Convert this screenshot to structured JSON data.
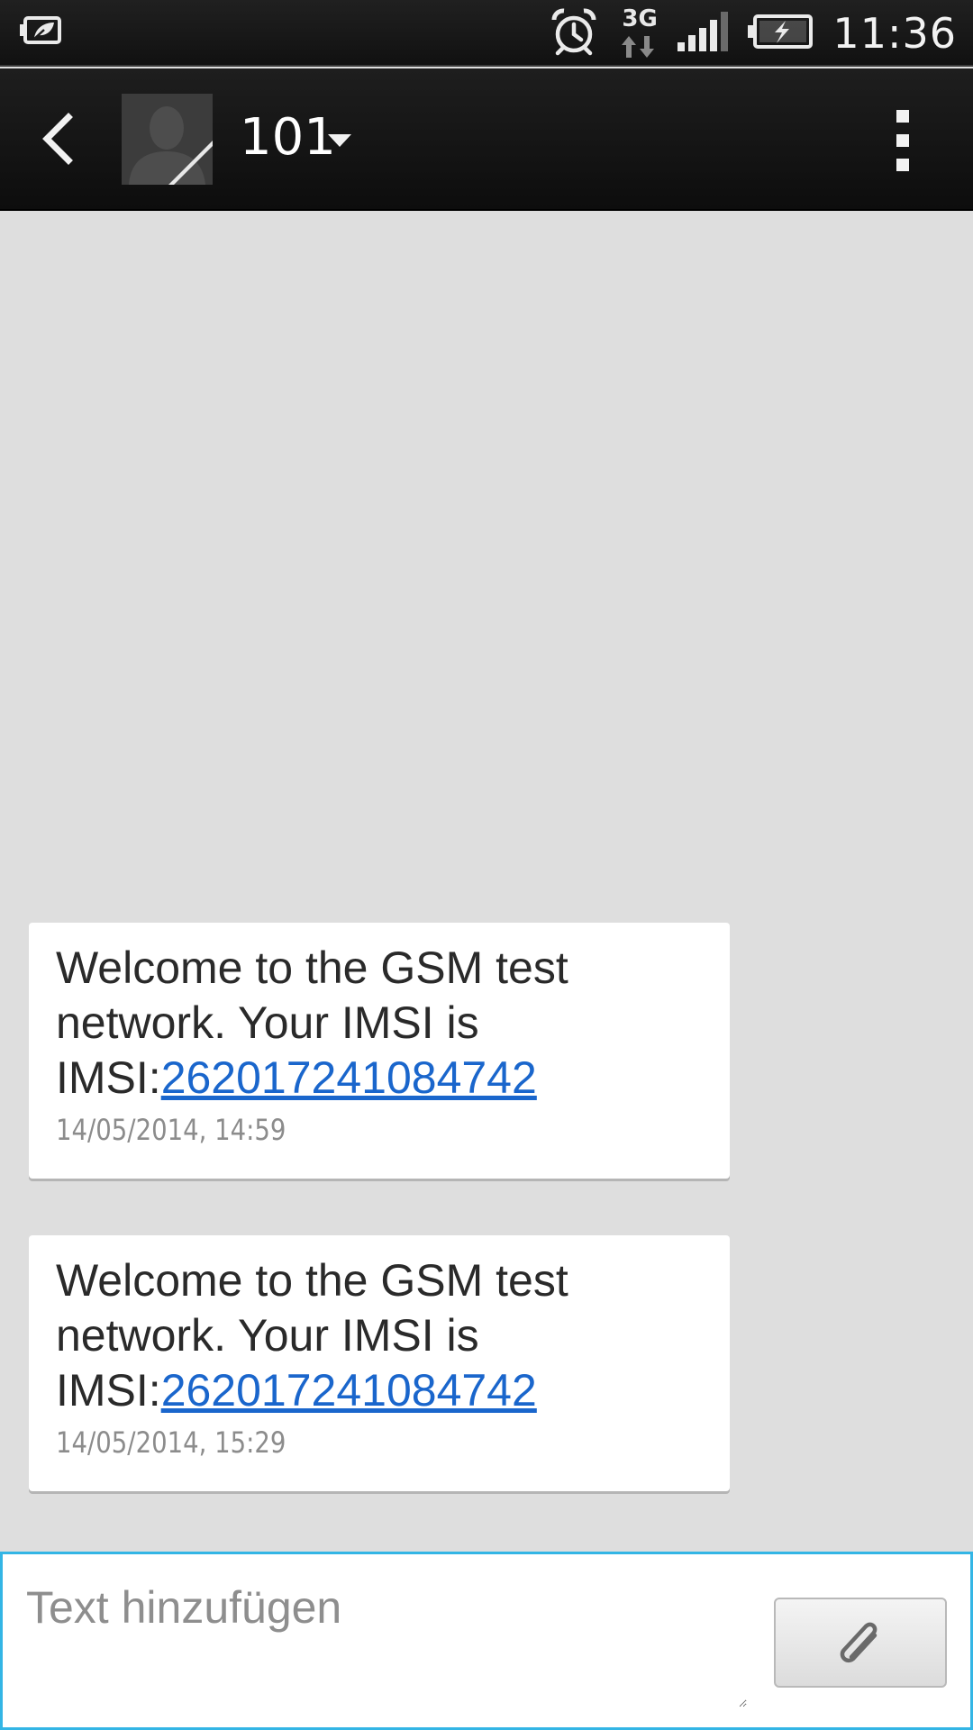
{
  "status_bar": {
    "left_icon": "power-saver-battery-leaf-icon",
    "alarm_icon": "alarm-clock-icon",
    "network_type": "3G",
    "signal_icon": "signal-strength-icon",
    "battery_icon": "battery-charging-icon",
    "time": "11:36"
  },
  "action_bar": {
    "back_icon": "chevron-left-icon",
    "avatar_icon": "contact-avatar-icon",
    "contact_name": "101",
    "dropdown_icon": "caret-down-icon",
    "menu_icon": "overflow-menu-icon"
  },
  "messages": [
    {
      "text_prefix": "Welcome to the GSM test network.  Your IMSI is IMSI:",
      "link": "262017241084742",
      "timestamp": "14/05/2014, 14:59"
    },
    {
      "text_prefix": "Welcome to the GSM test network.  Your IMSI is IMSI:",
      "link": "262017241084742",
      "timestamp": "14/05/2014, 15:29"
    }
  ],
  "compose": {
    "placeholder": "Text hinzufügen",
    "value": "",
    "attach_icon": "paperclip-icon"
  },
  "colors": {
    "background": "#dedede",
    "link": "#1a66cc",
    "accent": "#33b5e5",
    "bar": "#111111"
  }
}
